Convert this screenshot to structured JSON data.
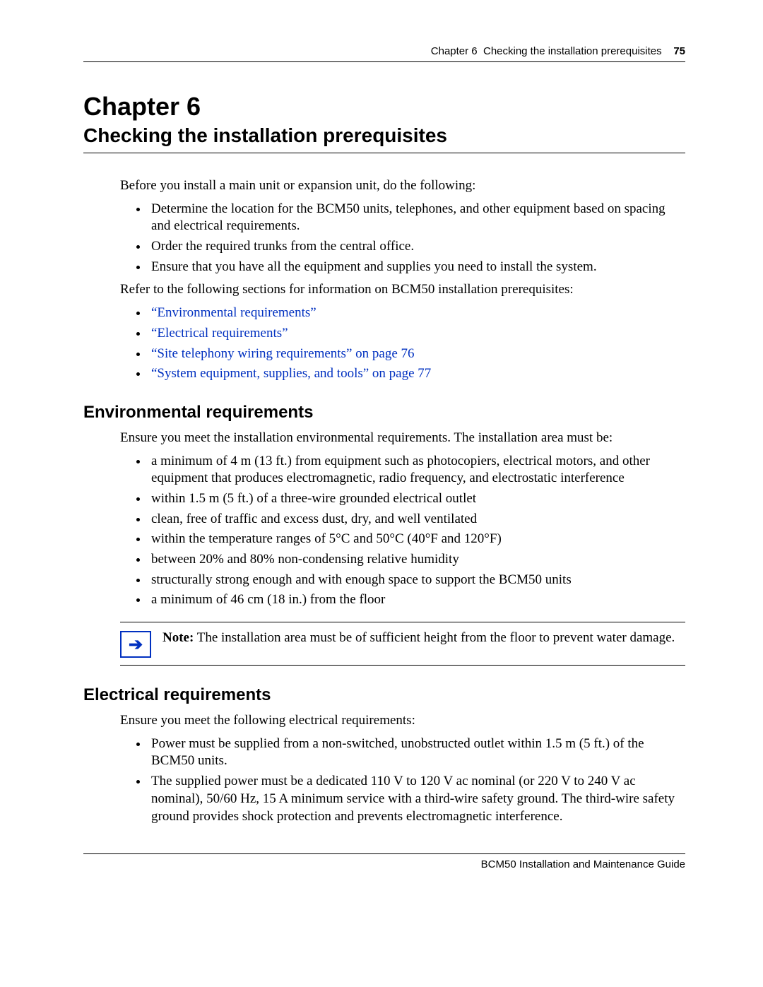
{
  "header": {
    "chapter_ref": "Chapter 6",
    "chapter_name": "Checking the installation prerequisites",
    "page_number": "75"
  },
  "chapter": {
    "line1": "Chapter 6",
    "line2": "Checking the installation prerequisites"
  },
  "intro": {
    "p1": "Before you install a main unit or expansion unit, do the following:",
    "bullets": [
      "Determine the location for the BCM50 units, telephones, and other equipment based on spacing and electrical requirements.",
      "Order the required trunks from the central office.",
      "Ensure that you have all the equipment and supplies you need to install the system."
    ],
    "p2": "Refer to the following sections for information on BCM50 installation prerequisites:",
    "links": [
      "“Environmental requirements”",
      "“Electrical requirements”",
      "“Site telephony wiring requirements” on page 76",
      "“System equipment, supplies, and tools” on page 77"
    ]
  },
  "env": {
    "heading": "Environmental requirements",
    "p1": "Ensure you meet the installation environmental requirements. The installation area must be:",
    "bullets": [
      "a minimum of 4 m (13 ft.) from equipment such as photocopiers, electrical motors, and other equipment that produces electromagnetic, radio frequency, and electrostatic interference",
      "within 1.5 m (5 ft.) of a three-wire grounded electrical outlet",
      "clean, free of traffic and excess dust, dry, and well ventilated",
      "within the temperature ranges of 5°C and 50°C (40°F and 120°F)",
      "between 20% and 80% non-condensing relative humidity",
      "structurally strong enough and with enough space to support the BCM50 units",
      "a minimum of 46 cm (18 in.) from the floor"
    ],
    "note_label": "Note:",
    "note_body": "The installation area must be of sufficient height from the floor to prevent water damage."
  },
  "elec": {
    "heading": "Electrical requirements",
    "p1": "Ensure you meet the following electrical requirements:",
    "bullets": [
      "Power must be supplied from a non-switched, unobstructed outlet within 1.5 m (5 ft.) of the BCM50 units.",
      "The supplied power must be a dedicated 110 V to 120 V ac nominal (or 220 V to 240 V ac nominal), 50/60 Hz, 15 A minimum service with a third-wire safety ground. The third-wire safety ground provides shock protection and prevents electromagnetic interference."
    ]
  },
  "footer": {
    "text": "BCM50 Installation and Maintenance Guide"
  }
}
